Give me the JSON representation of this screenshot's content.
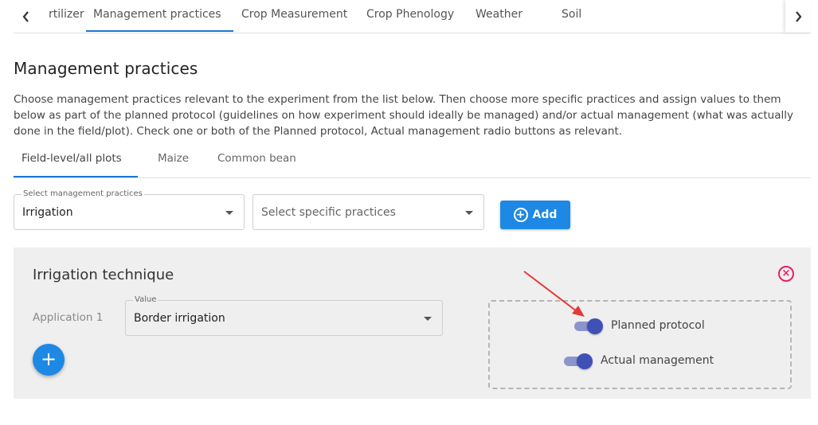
{
  "top_tabs": {
    "prev_icon": "chevron-left-icon",
    "next_icon": "chevron-right-icon",
    "items": [
      {
        "label": "rtilizer"
      },
      {
        "label": "Management practices"
      },
      {
        "label": "Crop Measurement"
      },
      {
        "label": "Crop Phenology"
      },
      {
        "label": "Weather"
      },
      {
        "label": "Soil"
      }
    ],
    "active": "Management practices"
  },
  "page": {
    "title": "Management practices",
    "description": "Choose management practices relevant to the experiment from the list below. Then choose more specific practices and assign values to them below as part of the planned protocol (guidelines on how experiment should ideally be managed) and/or actual management (what was actually done in the field/plot). Check one or both of the Planned protocol, Actual management radio buttons as relevant."
  },
  "sub_tabs": {
    "items": [
      {
        "label": "Field-level/all plots"
      },
      {
        "label": "Maize"
      },
      {
        "label": "Common bean"
      }
    ],
    "active": "Field-level/all plots"
  },
  "filters": {
    "practice_select": {
      "label": "Select management practices",
      "value": "Irrigation"
    },
    "specific_select": {
      "placeholder": "Select specific practices"
    },
    "add_button": {
      "label": "Add",
      "icon": "plus-circle-icon"
    }
  },
  "card": {
    "title": "Irrigation technique",
    "application_label": "Application 1",
    "value_field": {
      "label": "Value",
      "value": "Border irrigation"
    },
    "fab_icon": "plus-icon",
    "close_icon": "close-circle-icon",
    "toggles": [
      {
        "label": "Planned protocol",
        "checked": true
      },
      {
        "label": "Actual management",
        "checked": true
      }
    ]
  },
  "colors": {
    "primary": "#1e88e5",
    "toggle_thumb": "#3f51b5",
    "close": "#e91e63",
    "annotation_arrow": "#e53935"
  }
}
